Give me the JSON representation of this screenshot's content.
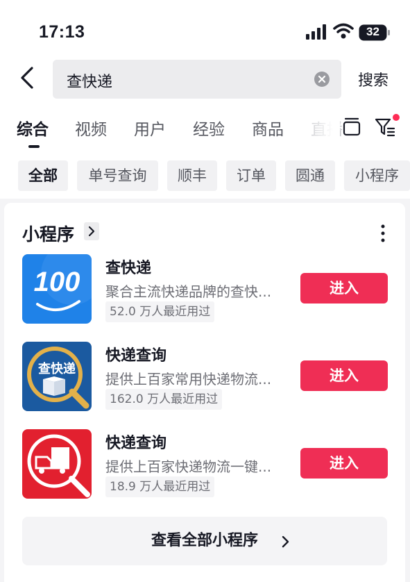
{
  "status_bar": {
    "time": "17:13",
    "battery": "32"
  },
  "search": {
    "query": "查快递",
    "submit_label": "搜索"
  },
  "tabs": [
    {
      "label": "综合",
      "active": true
    },
    {
      "label": "视频",
      "active": false
    },
    {
      "label": "用户",
      "active": false
    },
    {
      "label": "经验",
      "active": false
    },
    {
      "label": "商品",
      "active": false
    },
    {
      "label": "直播",
      "active": false
    }
  ],
  "filter_chips": [
    {
      "label": "全部",
      "active": true
    },
    {
      "label": "单号查询",
      "active": false
    },
    {
      "label": "顺丰",
      "active": false
    },
    {
      "label": "订单",
      "active": false
    },
    {
      "label": "圆通",
      "active": false
    },
    {
      "label": "小程序",
      "active": false
    }
  ],
  "mini_programs": {
    "section_title": "小程序",
    "items": [
      {
        "name": "查快递",
        "description": "聚合主流快递品牌的查快...",
        "users": "52.0 万人最近用过",
        "action": "进入",
        "icon": "kuaidi100-icon",
        "icon_text": "100"
      },
      {
        "name": "快递查询",
        "description": "提供上百家常用快递物流...",
        "users": "162.0 万人最近用过",
        "action": "进入",
        "icon": "package-search-icon",
        "icon_text": "查快递"
      },
      {
        "name": "快递查询",
        "description": "提供上百家快递物流一键...",
        "users": "18.9 万人最近用过",
        "action": "进入",
        "icon": "truck-search-icon"
      }
    ],
    "view_all_label": "查看全部小程序"
  },
  "colors": {
    "accent": "#ef2e55",
    "notification_dot": "#fe2c55"
  }
}
